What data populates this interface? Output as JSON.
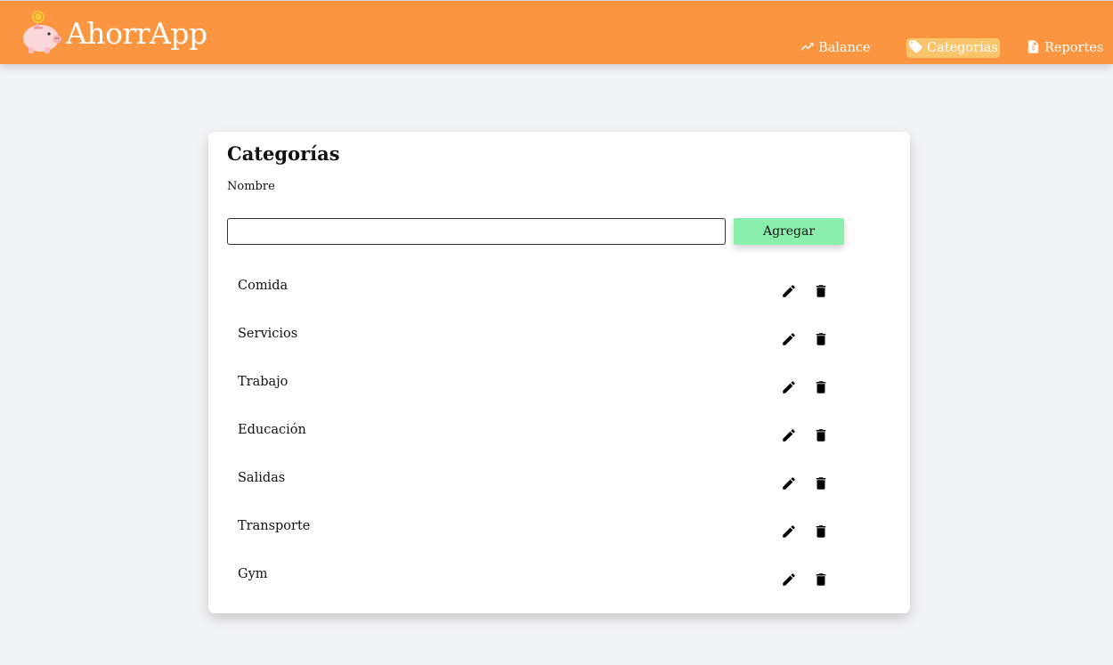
{
  "app": {
    "name": "AhorrApp",
    "logo_icon": "piggy-bank-icon"
  },
  "nav": {
    "items": [
      {
        "label": "Balance",
        "icon": "trending-up-icon",
        "active": false
      },
      {
        "label": "Categorías",
        "icon": "tag-icon",
        "active": true
      },
      {
        "label": "Reportes",
        "icon": "report-file-icon",
        "active": false
      }
    ]
  },
  "categories_panel": {
    "title": "Categorías",
    "name_label": "Nombre",
    "name_value": "",
    "add_label": "Agregar",
    "items": [
      {
        "name": "Comida"
      },
      {
        "name": "Servicios"
      },
      {
        "name": "Trabajo"
      },
      {
        "name": "Educación"
      },
      {
        "name": "Salidas"
      },
      {
        "name": "Transporte"
      },
      {
        "name": "Gym"
      }
    ]
  },
  "colors": {
    "navbar": "#fb953f",
    "active_nav": "#fac56a",
    "add_button": "#8aefad",
    "background": "#f3f4f6"
  }
}
